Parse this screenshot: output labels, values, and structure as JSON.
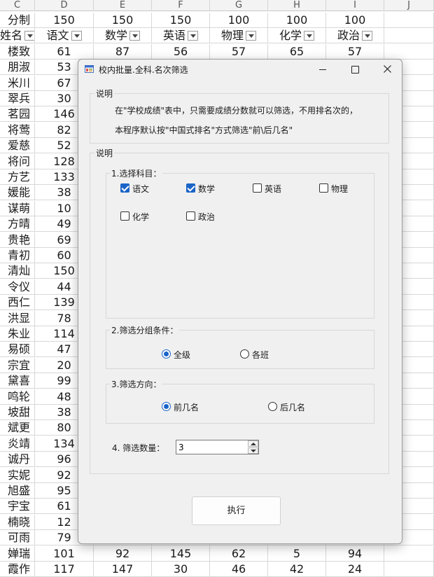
{
  "sheet": {
    "columns": [
      {
        "letter": "C",
        "w": 50
      },
      {
        "letter": "D",
        "w": 84
      },
      {
        "letter": "E",
        "w": 83
      },
      {
        "letter": "F",
        "w": 83
      },
      {
        "letter": "G",
        "w": 83
      },
      {
        "letter": "H",
        "w": 83
      },
      {
        "letter": "I",
        "w": 83
      },
      {
        "letter": "J",
        "w": 71
      }
    ],
    "score_row": [
      "分制",
      "150",
      "150",
      "150",
      "100",
      "100",
      "100",
      ""
    ],
    "header_row": [
      "姓名",
      "语文",
      "数学",
      "英语",
      "物理",
      "化学",
      "政治",
      ""
    ],
    "rows": [
      [
        "楼致",
        "61",
        "87",
        "56",
        "57",
        "65",
        "57"
      ],
      [
        "朋淑",
        "53"
      ],
      [
        "米川",
        "67"
      ],
      [
        "翠兵",
        "30"
      ],
      [
        "茗园",
        "146"
      ],
      [
        "将莺",
        "82"
      ],
      [
        "爱慈",
        "52"
      ],
      [
        "将问",
        "128"
      ],
      [
        "方艺",
        "133"
      ],
      [
        "媛能",
        "38"
      ],
      [
        "谋萌",
        "10"
      ],
      [
        "方晴",
        "49"
      ],
      [
        "贵艳",
        "69"
      ],
      [
        "青初",
        "60"
      ],
      [
        "清灿",
        "150"
      ],
      [
        "令仪",
        "44"
      ],
      [
        "西仁",
        "139"
      ],
      [
        "洪显",
        "78"
      ],
      [
        "朱业",
        "114"
      ],
      [
        "易硕",
        "47"
      ],
      [
        "宗宜",
        "20"
      ],
      [
        "黛喜",
        "99"
      ],
      [
        "鸣轮",
        "48"
      ],
      [
        "坡甜",
        "38"
      ],
      [
        "斌更",
        "80"
      ],
      [
        "炎靖",
        "134"
      ],
      [
        "诚丹",
        "96"
      ],
      [
        "实妮",
        "92"
      ],
      [
        "旭盛",
        "95"
      ],
      [
        "宇宝",
        "61"
      ],
      [
        "楠晓",
        "12"
      ],
      [
        "可雨",
        "79"
      ],
      [
        "婵瑞",
        "101",
        "92",
        "145",
        "62",
        "5",
        "94"
      ],
      [
        "霞作",
        "117",
        "147",
        "30",
        "46",
        "42",
        "24"
      ]
    ]
  },
  "dialog": {
    "title": "校内批量.全科.名次筛选",
    "desc_group": {
      "legend": "说明",
      "line1": "在\"学校成绩\"表中，只需要成绩分数就可以筛选，不用排名次的，",
      "line2": "本程序默认按\"中国式排名\"方式筛选\"前\\后几名\""
    },
    "main_group": {
      "legend": "说明"
    },
    "subjects": {
      "legend": "1.选择科目：",
      "items": [
        {
          "label": "语文",
          "checked": true
        },
        {
          "label": "数学",
          "checked": true
        },
        {
          "label": "英语",
          "checked": false
        },
        {
          "label": "物理",
          "checked": false
        },
        {
          "label": "化学",
          "checked": false
        },
        {
          "label": "政治",
          "checked": false
        }
      ]
    },
    "grouping": {
      "legend": "2.筛选分组条件：",
      "options": [
        {
          "label": "全级",
          "selected": true
        },
        {
          "label": "各班",
          "selected": false
        }
      ]
    },
    "direction": {
      "legend": "3.筛选方向：",
      "options": [
        {
          "label": "前几名",
          "selected": true
        },
        {
          "label": "后几名",
          "selected": false
        }
      ]
    },
    "count": {
      "label": "4. 筛选数量：",
      "value": "3"
    },
    "execute_label": "执行"
  },
  "colors": {
    "accent": "#1a64c8",
    "dialog_bg": "#f0f0f0"
  }
}
